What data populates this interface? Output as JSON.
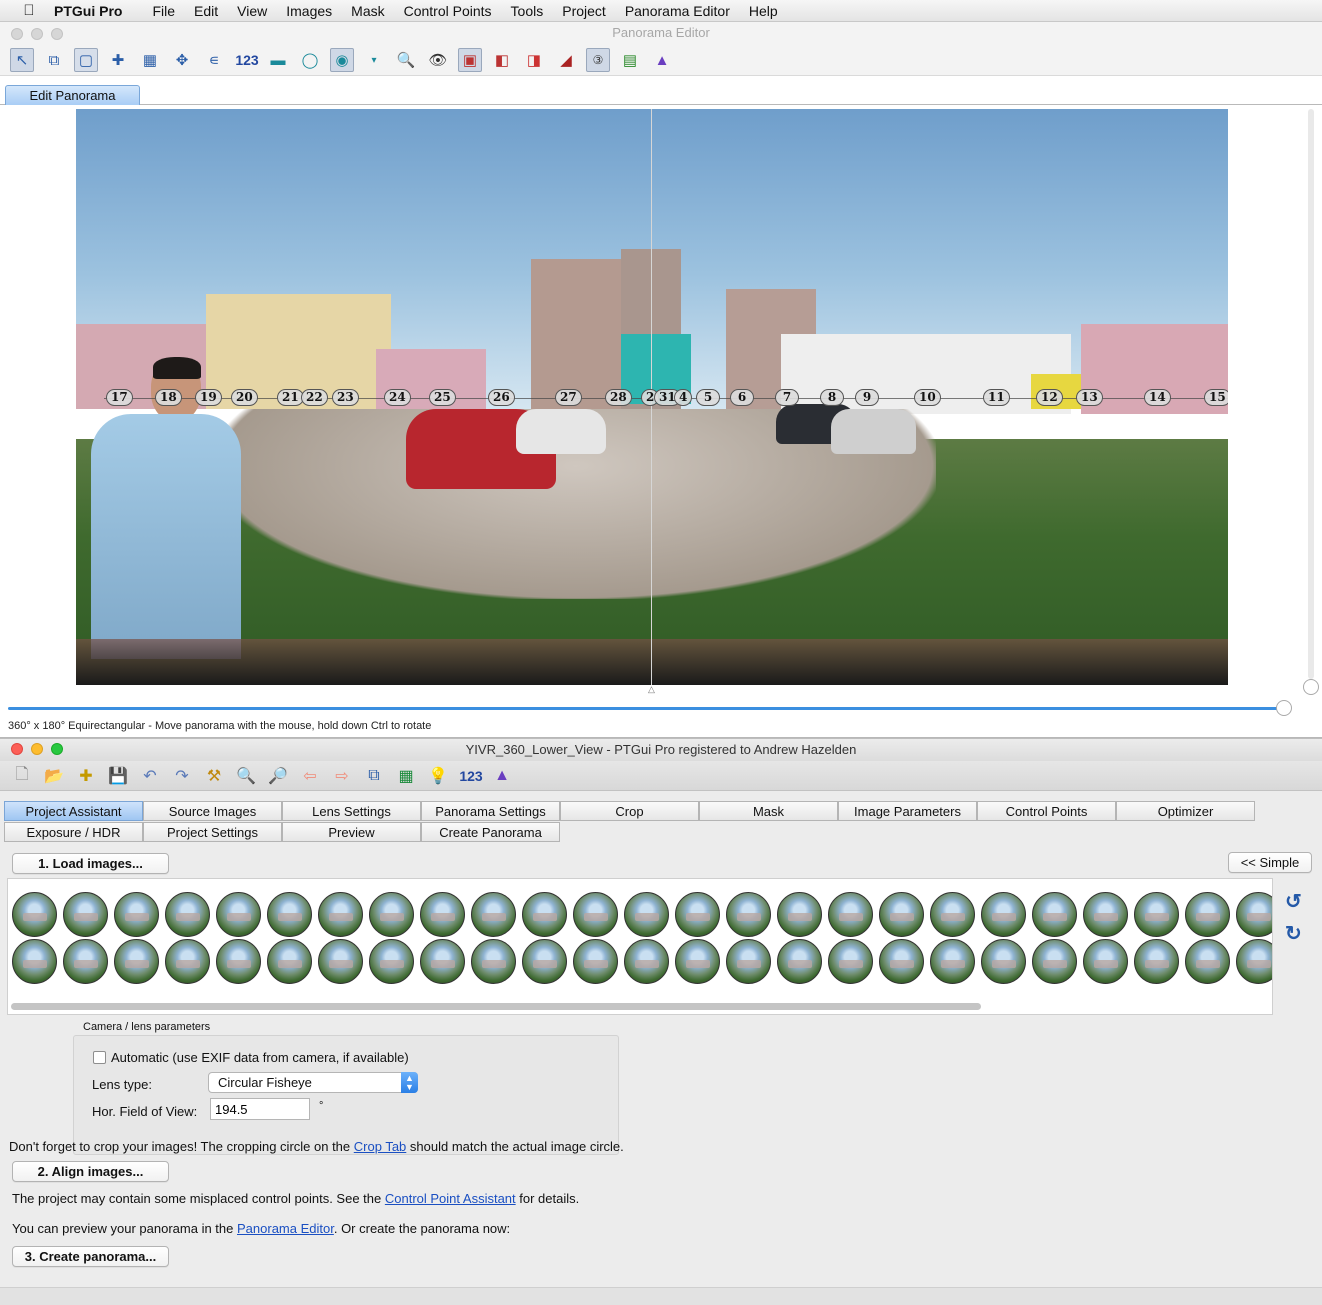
{
  "menubar": {
    "app_name": "PTGui Pro",
    "items": [
      "File",
      "Edit",
      "View",
      "Images",
      "Mask",
      "Control Points",
      "Tools",
      "Project",
      "Panorama Editor",
      "Help"
    ]
  },
  "panorama_editor": {
    "window_title": "Panorama Editor",
    "toolbar_123": "123",
    "tab_label": "Edit Panorama",
    "image_numbers": [
      "17",
      "18",
      "19",
      "20",
      "21",
      "22",
      "23",
      "24",
      "25",
      "26",
      "27",
      "28",
      "2",
      "31",
      "4",
      "5",
      "6",
      "7",
      "8",
      "9",
      "10",
      "11",
      "12",
      "13",
      "14",
      "15"
    ],
    "status_text": "360° x 180° Equirectangular - Move panorama with the mouse, hold down Ctrl to rotate"
  },
  "main_window": {
    "title": "YIVR_360_Lower_View - PTGui Pro registered to Andrew Hazelden",
    "toolbar_123": "123",
    "tabs_row1": [
      "Project Assistant",
      "Source Images",
      "Lens Settings",
      "Panorama Settings",
      "Crop",
      "Mask",
      "Image Parameters",
      "Control Points",
      "Optimizer"
    ],
    "tabs_row2": [
      "Exposure / HDR",
      "Project Settings",
      "Preview",
      "Create Panorama"
    ],
    "active_tab": "Project Assistant",
    "load_images_button": "1. Load images...",
    "simple_button": "<< Simple",
    "camera_group_label": "Camera / lens parameters",
    "automatic_checkbox_label": "Automatic (use EXIF data from camera, if available)",
    "automatic_checked": false,
    "lens_type_label": "Lens type:",
    "lens_type_value": "Circular Fisheye",
    "hfov_label": "Hor. Field of View:",
    "hfov_value": "194.5",
    "hfov_unit": "°",
    "crop_note_prefix": "Don't forget to crop your images! The cropping circle on the ",
    "crop_note_link": "Crop Tab",
    "crop_note_suffix": " should match the actual image circle.",
    "align_button": "2. Align images...",
    "cp_note_prefix": "The project may contain some misplaced control points. See the ",
    "cp_note_link": "Control Point Assistant",
    "cp_note_suffix": " for details.",
    "preview_note_prefix": "You can preview your panorama in the ",
    "preview_note_link": "Panorama Editor",
    "preview_note_suffix": ". Or create the panorama now:",
    "create_button": "3. Create panorama..."
  },
  "colors": {
    "accent": "#3b8fe0",
    "link": "#1a4fc2",
    "active_tab": "#a9cdf5"
  }
}
